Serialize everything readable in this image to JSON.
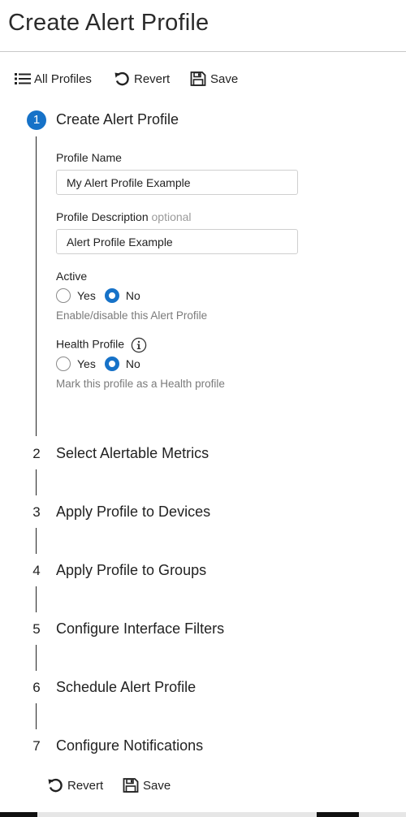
{
  "page": {
    "title": "Create Alert Profile"
  },
  "toolbar": {
    "all_profiles_label": "All Profiles",
    "revert_label": "Revert",
    "save_label": "Save"
  },
  "steps": [
    {
      "number": "1",
      "title": "Create Alert Profile",
      "active": true
    },
    {
      "number": "2",
      "title": "Select Alertable Metrics"
    },
    {
      "number": "3",
      "title": "Apply Profile to Devices"
    },
    {
      "number": "4",
      "title": "Apply Profile to Groups"
    },
    {
      "number": "5",
      "title": "Configure Interface Filters"
    },
    {
      "number": "6",
      "title": "Schedule Alert Profile"
    },
    {
      "number": "7",
      "title": "Configure Notifications"
    }
  ],
  "form": {
    "profile_name": {
      "label": "Profile Name",
      "value": "My Alert Profile Example"
    },
    "profile_description": {
      "label": "Profile Description",
      "optional_label": "optional",
      "value": "Alert Profile Example"
    },
    "active": {
      "label": "Active",
      "yes_label": "Yes",
      "no_label": "No",
      "selected": "No",
      "help": "Enable/disable this Alert Profile"
    },
    "health_profile": {
      "label": "Health Profile",
      "yes_label": "Yes",
      "no_label": "No",
      "selected": "No",
      "help": "Mark this profile as a Health profile"
    }
  },
  "footer": {
    "revert_label": "Revert",
    "save_label": "Save"
  },
  "colors": {
    "accent": "#1672c8",
    "help_text": "#7b7b7b",
    "rule": "#c9c9c9"
  },
  "icons": [
    "list-icon",
    "revert-icon",
    "save-icon",
    "info-icon"
  ]
}
